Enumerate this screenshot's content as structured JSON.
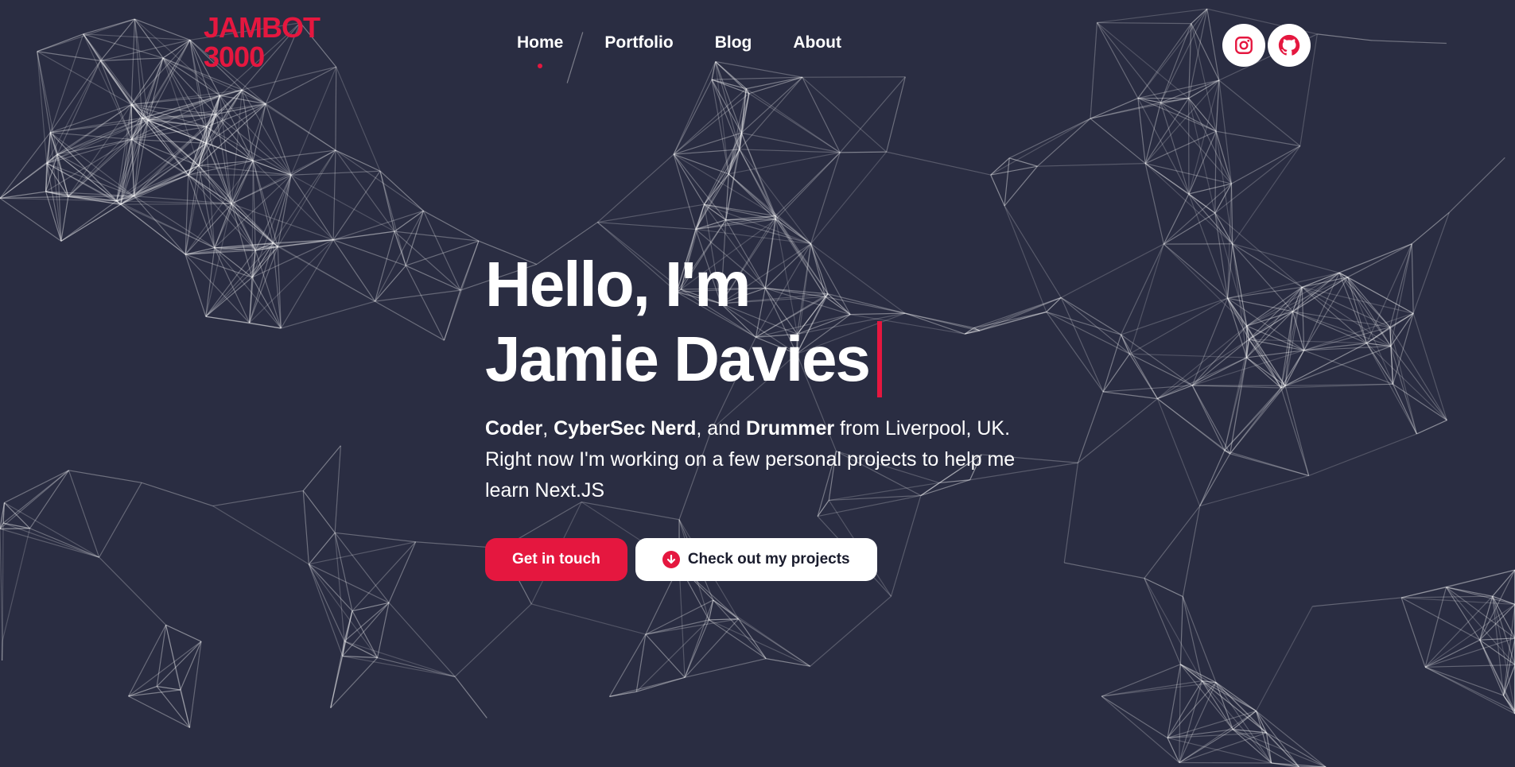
{
  "brand": {
    "logo_text": "JAMBOT\n3000",
    "accent_color": "#e5173f",
    "background_color": "#2a2d42"
  },
  "nav": {
    "items": [
      {
        "label": "Home",
        "active": true
      },
      {
        "label": "Portfolio",
        "active": false
      },
      {
        "label": "Blog",
        "active": false
      },
      {
        "label": "About",
        "active": false
      }
    ]
  },
  "socials": [
    {
      "icon": "instagram-icon"
    },
    {
      "icon": "github-icon"
    }
  ],
  "hero": {
    "headline_line1": "Hello, I'm",
    "headline_line2": "Jamie Davies",
    "intro": {
      "role1": "Coder",
      "sep1": ", ",
      "role2": "CyberSec Nerd",
      "sep2": ", and ",
      "role3": "Drummer",
      "rest": " from Liverpool, UK. Right now I'm working on a few personal projects to help me learn Next.JS"
    },
    "primary_button": "Get in touch",
    "secondary_button": "Check out my projects",
    "secondary_button_icon": "arrow-down-circle-icon"
  }
}
